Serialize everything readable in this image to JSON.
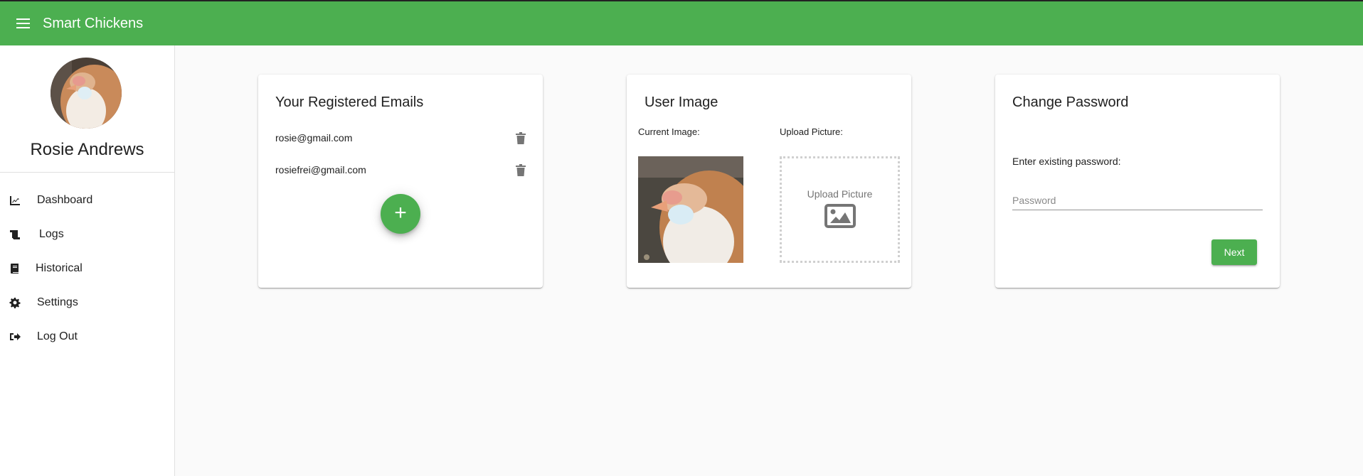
{
  "app": {
    "title": "Smart Chickens",
    "brand_color": "#4caf50"
  },
  "sidebar": {
    "user_name": "Rosie Andrews",
    "avatar_alt": "chicken profile photo",
    "items": [
      {
        "label": "Dashboard",
        "icon": "chart-line-icon"
      },
      {
        "label": "Logs",
        "icon": "scroll-icon"
      },
      {
        "label": "Historical",
        "icon": "book-icon"
      },
      {
        "label": "Settings",
        "icon": "gear-icon"
      },
      {
        "label": "Log Out",
        "icon": "sign-out-icon"
      }
    ]
  },
  "emails_card": {
    "title": "Your Registered Emails",
    "emails": [
      "rosie@gmail.com",
      "rosiefrei@gmail.com"
    ],
    "add_label": "+"
  },
  "image_card": {
    "title": "User Image",
    "current_label": "Current Image:",
    "upload_label": "Upload Picture:",
    "upload_box_text": "Upload Picture"
  },
  "password_card": {
    "title": "Change Password",
    "field_label": "Enter existing password:",
    "placeholder": "Password",
    "value": "",
    "next_label": "Next"
  }
}
